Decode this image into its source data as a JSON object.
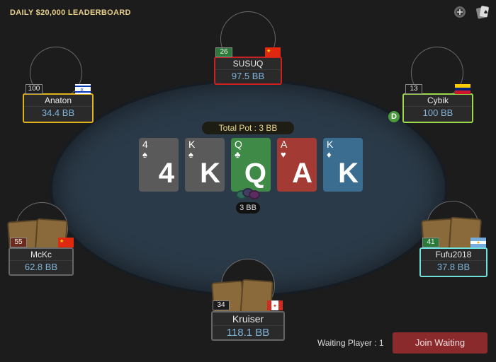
{
  "header": {
    "leaderboard": "DAILY $20,000 LEADERBOARD"
  },
  "top_icons": [
    {
      "name": "add-chip-icon",
      "glyph": "⊕"
    },
    {
      "name": "cards-icon",
      "glyph": "♠"
    }
  ],
  "pot": {
    "label": "Total Pot : 3 BB"
  },
  "board": [
    {
      "rank": "4",
      "suit": "♠",
      "suit_name": "spade"
    },
    {
      "rank": "K",
      "suit": "♠",
      "suit_name": "spade"
    },
    {
      "rank": "Q",
      "suit": "♣",
      "suit_name": "club"
    },
    {
      "rank": "A",
      "suit": "♥",
      "suit_name": "heart"
    },
    {
      "rank": "K",
      "suit": "♦",
      "suit_name": "diamond"
    }
  ],
  "bet": {
    "amount": "3 BB"
  },
  "players": {
    "susuq": {
      "name": "SUSUQ",
      "stack": "97.5 BB",
      "level": "26",
      "border": "#cc1f1f",
      "level_color": "#2c7a3a",
      "flag": "China"
    },
    "anaton": {
      "name": "Anaton",
      "stack": "34.4 BB",
      "level": "100",
      "border": "#e0b21c",
      "level_color": "#1c1c1c",
      "flag": "Israel"
    },
    "cybik": {
      "name": "Cybik",
      "stack": "100 BB",
      "level": "13",
      "border": "#9bd84a",
      "level_color": "#1c1c1c",
      "flag": "Venezuela"
    },
    "mckc": {
      "name": "McKc",
      "stack": "62.8 BB",
      "level": "55",
      "border": "#666666",
      "level_color": "#6b2a1c",
      "flag": "China"
    },
    "fufu": {
      "name": "Fufu2018",
      "stack": "37.8 BB",
      "level": "41",
      "border": "#6fe0dc",
      "level_color": "#2c7a3a",
      "flag": "Argentina"
    },
    "kruiser": {
      "name": "Kruiser",
      "stack": "118.1 BB",
      "level": "34",
      "border": "#666666",
      "level_color": "#1c1c1c",
      "flag": "Canada"
    }
  },
  "dealer": {
    "label": "D"
  },
  "footer": {
    "waiting": "Waiting Player : 1",
    "join_label": "Join Waiting"
  }
}
